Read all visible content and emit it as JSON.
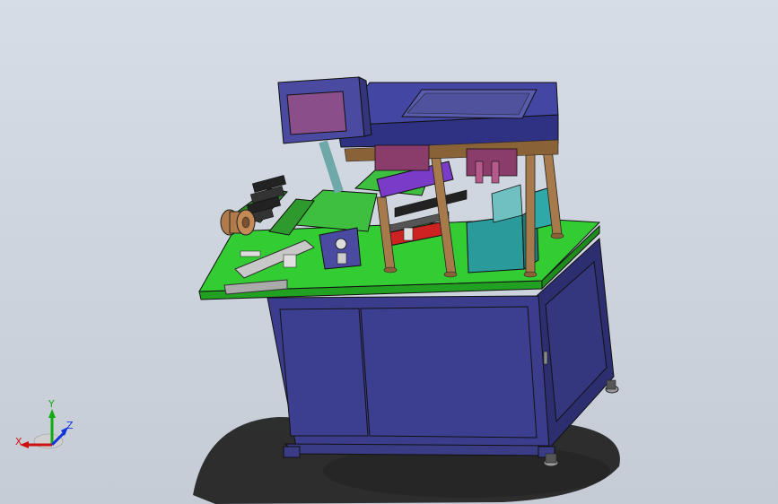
{
  "viewport": {
    "background_top": "#d7dde6",
    "background_bottom": "#c6ccd6"
  },
  "model": {
    "colors": {
      "cabinet": "#3b3d8c",
      "cabinet_dark": "#2c2e70",
      "table_top": "#33cc33",
      "table_top_dark": "#22a022",
      "top_plate": "#4346a2",
      "top_plate_dark": "#2f3183",
      "column": "#a67a4a",
      "screen_frame": "#4a4aa0",
      "screen_glass": "#8a4f8a",
      "teal_block": "#2a9a9a",
      "red_part": "#cc2222",
      "purple_part": "#7a3cc8",
      "shadow": "#1c1c1c"
    }
  },
  "triad": {
    "x_label": "X",
    "y_label": "Y",
    "z_label": "Z",
    "x_color": "#cc1111",
    "y_color": "#11aa11",
    "z_color": "#1133dd"
  }
}
